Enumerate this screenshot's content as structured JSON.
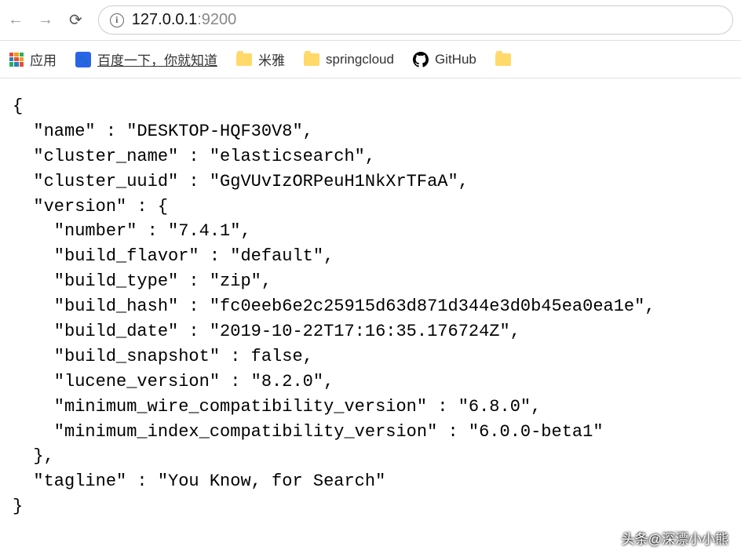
{
  "toolbar": {
    "url_host": "127.0.0.1",
    "url_port": ":9200"
  },
  "bookmarks": {
    "apps_label": "应用",
    "baidu_label": "百度一下，你就知道",
    "folder1_label": "米雅",
    "folder2_label": "springcloud",
    "github_label": "GitHub"
  },
  "json_response": {
    "line1": "{",
    "line2": "  \"name\" : \"DESKTOP-HQF30V8\",",
    "line3": "  \"cluster_name\" : \"elasticsearch\",",
    "line4": "  \"cluster_uuid\" : \"GgVUvIzORPeuH1NkXrTFaA\",",
    "line5": "  \"version\" : {",
    "line6": "    \"number\" : \"7.4.1\",",
    "line7": "    \"build_flavor\" : \"default\",",
    "line8": "    \"build_type\" : \"zip\",",
    "line9": "    \"build_hash\" : \"fc0eeb6e2c25915d63d871d344e3d0b45ea0ea1e\",",
    "line10": "    \"build_date\" : \"2019-10-22T17:16:35.176724Z\",",
    "line11": "    \"build_snapshot\" : false,",
    "line12": "    \"lucene_version\" : \"8.2.0\",",
    "line13": "    \"minimum_wire_compatibility_version\" : \"6.8.0\",",
    "line14": "    \"minimum_index_compatibility_version\" : \"6.0.0-beta1\"",
    "line15": "  },",
    "line16": "  \"tagline\" : \"You Know, for Search\"",
    "line17": "}"
  },
  "watermark": "头条@深漂小小熊"
}
